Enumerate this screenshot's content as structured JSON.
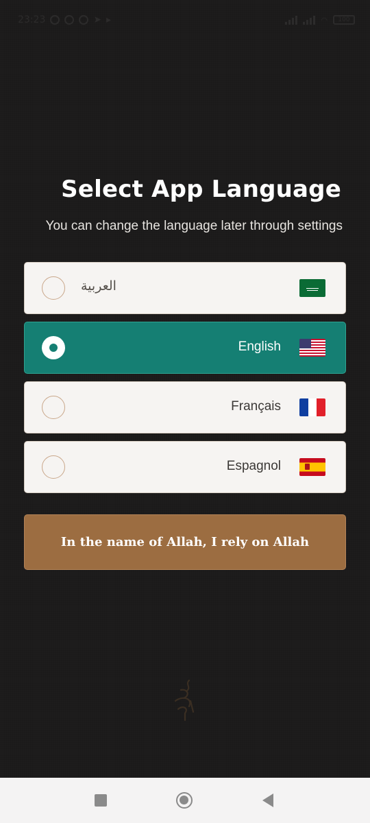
{
  "status_bar": {
    "time": "23:23",
    "battery": "100"
  },
  "header": {
    "title": "Select App Language",
    "subtitle": "You can change the language later through settings"
  },
  "languages": [
    {
      "label": "العربية",
      "flag": "saudi-arabia-flag",
      "selected": false
    },
    {
      "label": "English",
      "flag": "usa-flag",
      "selected": true
    },
    {
      "label": "Français",
      "flag": "france-flag",
      "selected": false
    },
    {
      "label": "Espagnol",
      "flag": "spain-flag",
      "selected": false
    }
  ],
  "cta": {
    "label": "In the name of Allah, I rely on Allah"
  },
  "colors": {
    "background": "#1b1a1a",
    "selected": "#157f73",
    "option_bg": "#f6f4f2",
    "cta": "#9c6d41",
    "radio_border": "#c9a78a"
  }
}
